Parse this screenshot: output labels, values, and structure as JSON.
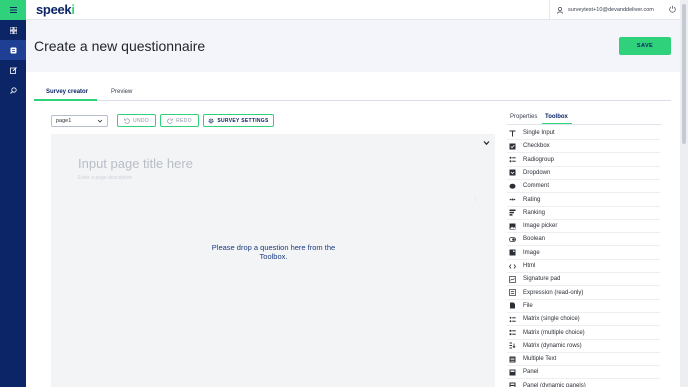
{
  "brand": {
    "logo_text": "speek",
    "logo_accent": "i",
    "accent_color": "#2fd27b",
    "nav_color": "#0b2566"
  },
  "sidebar": {
    "items": [
      {
        "icon": "menu-icon"
      },
      {
        "icon": "dashboard-icon"
      },
      {
        "icon": "survey-icon"
      },
      {
        "icon": "edit-icon"
      },
      {
        "icon": "search-icon"
      }
    ]
  },
  "topbar": {
    "user_email": "surveytest+10@devanddeliver.com",
    "user_icon": "user-icon",
    "logout_icon": "power-icon"
  },
  "header": {
    "title": "Create a new questionnaire",
    "save_label": "SAVE"
  },
  "tabs": {
    "survey_creator": "Survey creator",
    "preview": "Preview"
  },
  "toolbar": {
    "page_select": "page1",
    "undo": "UNDO",
    "redo": "REDO",
    "settings": "SURVEY SETTINGS"
  },
  "designer": {
    "page_title_placeholder": "Input page title here",
    "page_desc_placeholder": "Enter a page description",
    "drop_hint": "Please drop a question here from the Toolbox."
  },
  "panel": {
    "properties_tab": "Properties",
    "toolbox_tab": "Toolbox"
  },
  "toolbox": [
    {
      "label": "Single Input",
      "icon": "text-input-icon"
    },
    {
      "label": "Checkbox",
      "icon": "checkbox-icon"
    },
    {
      "label": "Radiogroup",
      "icon": "radiogroup-icon"
    },
    {
      "label": "Dropdown",
      "icon": "dropdown-icon"
    },
    {
      "label": "Comment",
      "icon": "comment-icon"
    },
    {
      "label": "Rating",
      "icon": "rating-icon"
    },
    {
      "label": "Ranking",
      "icon": "ranking-icon"
    },
    {
      "label": "Image picker",
      "icon": "image-picker-icon"
    },
    {
      "label": "Boolean",
      "icon": "boolean-icon"
    },
    {
      "label": "Image",
      "icon": "image-icon"
    },
    {
      "label": "Html",
      "icon": "html-icon"
    },
    {
      "label": "Signature pad",
      "icon": "signature-icon"
    },
    {
      "label": "Expression (read-only)",
      "icon": "expression-icon"
    },
    {
      "label": "File",
      "icon": "file-icon"
    },
    {
      "label": "Matrix (single choice)",
      "icon": "matrix-single-icon"
    },
    {
      "label": "Matrix (multiple choice)",
      "icon": "matrix-multiple-icon"
    },
    {
      "label": "Matrix (dynamic rows)",
      "icon": "matrix-dynamic-icon"
    },
    {
      "label": "Multiple Text",
      "icon": "multiple-text-icon"
    },
    {
      "label": "Panel",
      "icon": "panel-icon"
    },
    {
      "label": "Panel (dynamic panels)",
      "icon": "dynamic-panel-icon"
    }
  ]
}
